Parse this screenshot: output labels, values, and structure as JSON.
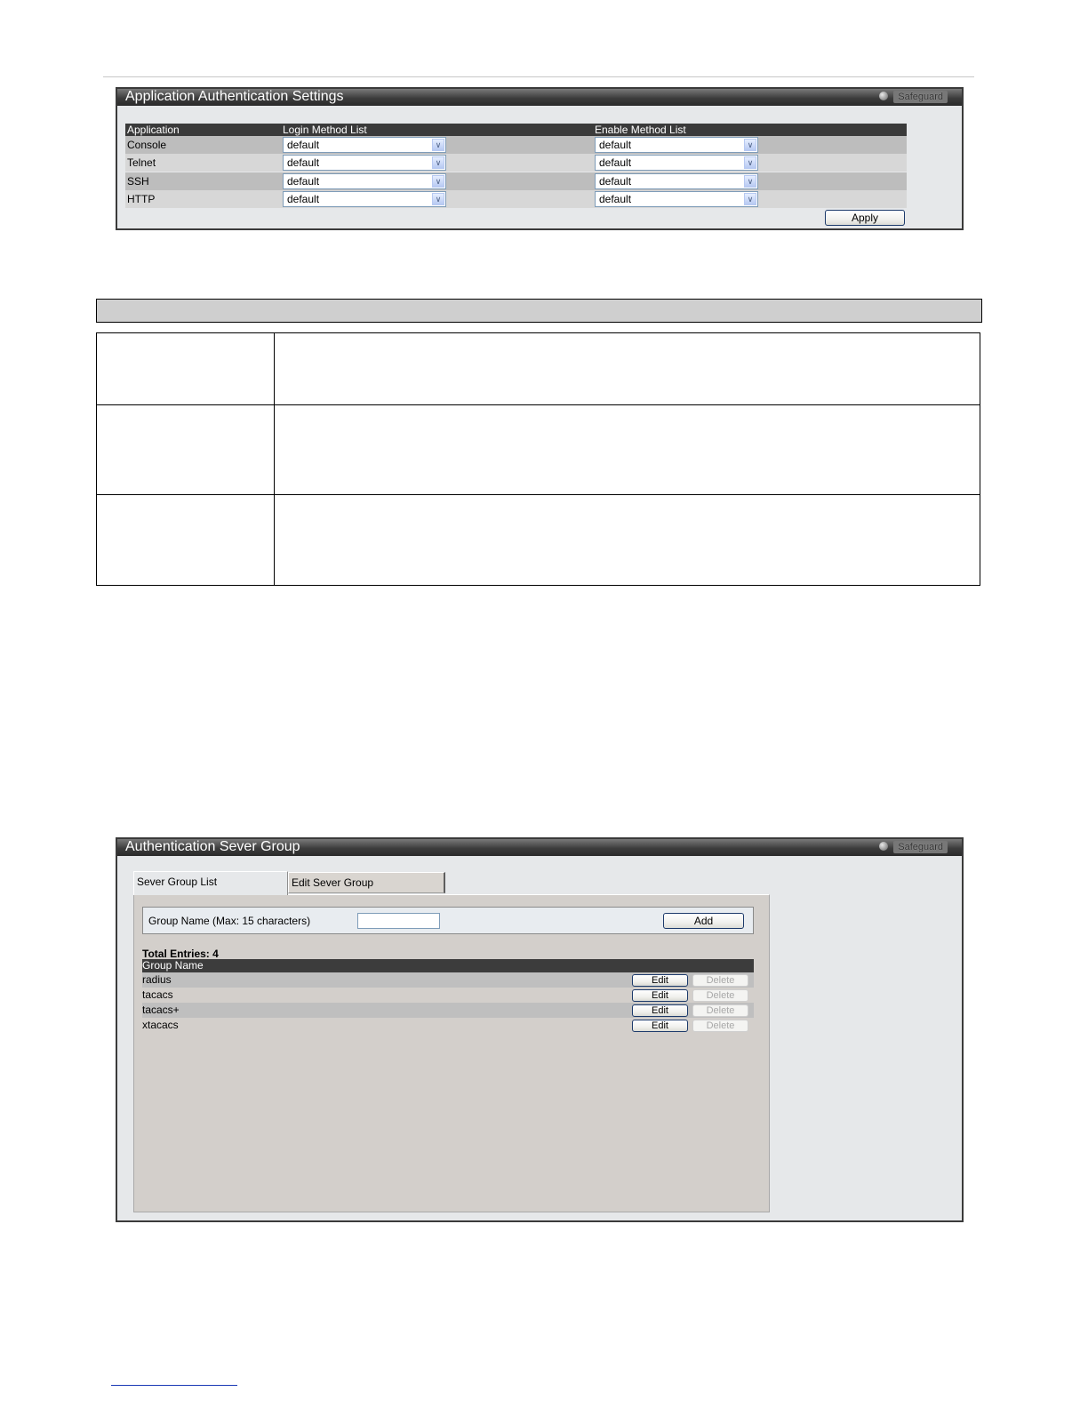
{
  "panel1": {
    "title": "Application Authentication Settings",
    "safeguard": "Safeguard",
    "headers": {
      "application": "Application",
      "login": "Login Method List",
      "enable": "Enable Method List"
    },
    "rows": [
      {
        "app": "Console",
        "login": "default",
        "enable": "default"
      },
      {
        "app": "Telnet",
        "login": "default",
        "enable": "default"
      },
      {
        "app": "SSH",
        "login": "default",
        "enable": "default"
      },
      {
        "app": "HTTP",
        "login": "default",
        "enable": "default"
      }
    ],
    "apply_label": "Apply"
  },
  "panel2": {
    "title": "Authentication Sever Group",
    "safeguard": "Safeguard",
    "tabs": [
      {
        "label": "Sever Group List",
        "active": true
      },
      {
        "label": "Edit Sever Group",
        "active": false
      }
    ],
    "group_name_label": "Group Name  (Max: 15 characters)",
    "group_name_value": "",
    "add_label": "Add",
    "total_entries": "Total Entries: 4",
    "column_header": "Group Name",
    "rows": [
      {
        "name": "radius",
        "edit": "Edit",
        "delete": "Delete"
      },
      {
        "name": "tacacs",
        "edit": "Edit",
        "delete": "Delete"
      },
      {
        "name": "tacacs+",
        "edit": "Edit",
        "delete": "Delete"
      },
      {
        "name": "xtacacs",
        "edit": "Edit",
        "delete": "Delete"
      }
    ]
  }
}
